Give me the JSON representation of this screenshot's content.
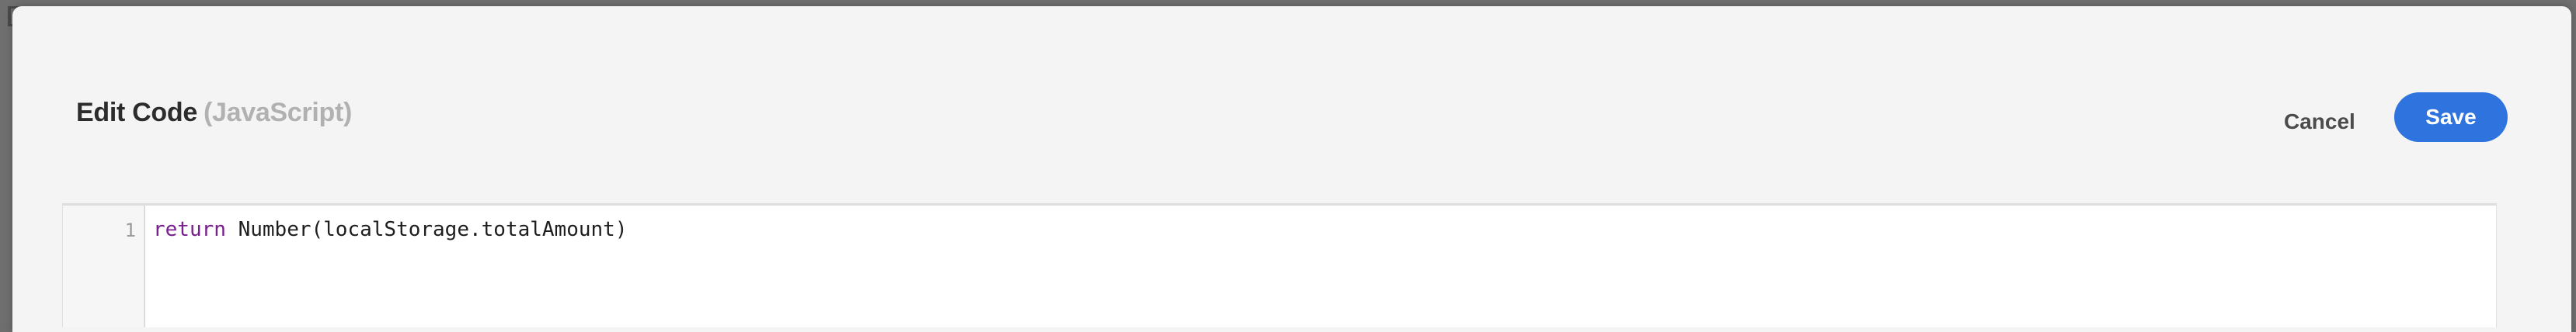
{
  "dialog": {
    "title": "Edit Code",
    "language": "(JavaScript)",
    "cancel_label": "Cancel",
    "save_label": "Save"
  },
  "editor": {
    "lines": [
      {
        "number": "1",
        "keyword": "return",
        "rest": " Number(localStorage.totalAmount)"
      }
    ],
    "keyword_color": "#7a1f8e"
  },
  "colors": {
    "accent": "#2f73de",
    "dialog_bg": "#f4f4f4",
    "overlay": "#6f6f6f"
  },
  "icons": {
    "background_left_top": "checkbox-icon",
    "background_left_mid": "more-vertical-icon"
  }
}
